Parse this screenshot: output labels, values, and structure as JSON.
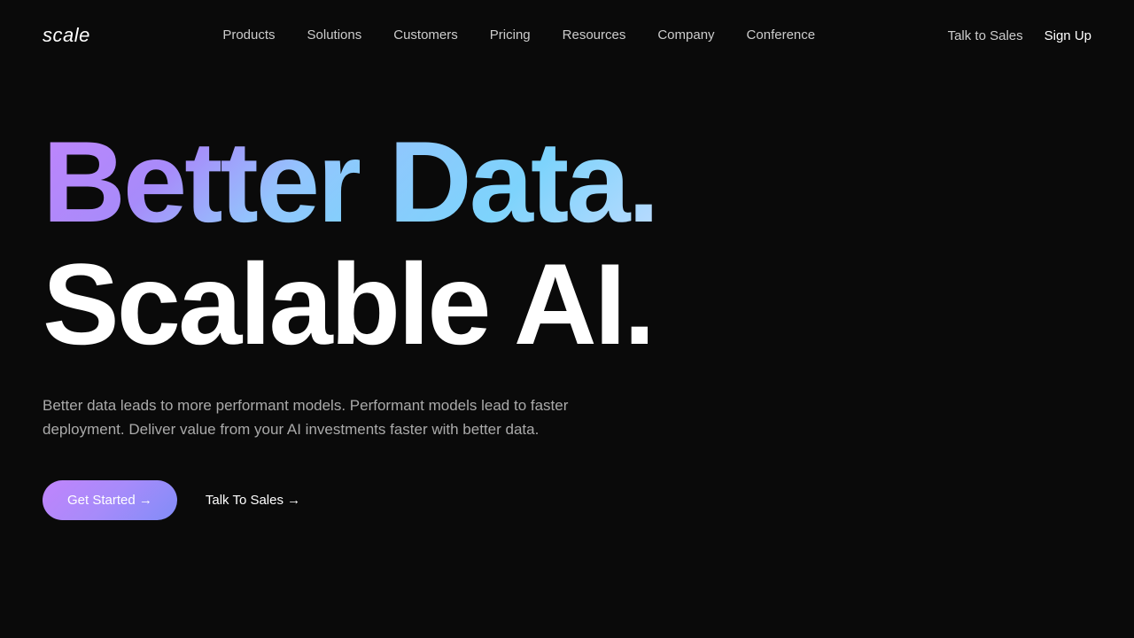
{
  "nav": {
    "logo": "scale",
    "links": [
      {
        "label": "Products",
        "id": "products"
      },
      {
        "label": "Solutions",
        "id": "solutions"
      },
      {
        "label": "Customers",
        "id": "customers"
      },
      {
        "label": "Pricing",
        "id": "pricing"
      },
      {
        "label": "Resources",
        "id": "resources"
      },
      {
        "label": "Company",
        "id": "company"
      },
      {
        "label": "Conference",
        "id": "conference"
      }
    ],
    "talk_to_sales": "Talk to Sales",
    "sign_up": "Sign Up"
  },
  "hero": {
    "headline_line1_word1": "Better",
    "headline_line1_word2": "Data.",
    "headline_line2": "Scalable AI.",
    "description": "Better data leads to more performant models. Performant models lead to faster deployment. Deliver value from your AI investments faster with better data.",
    "cta_primary": "Get Started →",
    "cta_secondary": "Talk To Sales →"
  }
}
